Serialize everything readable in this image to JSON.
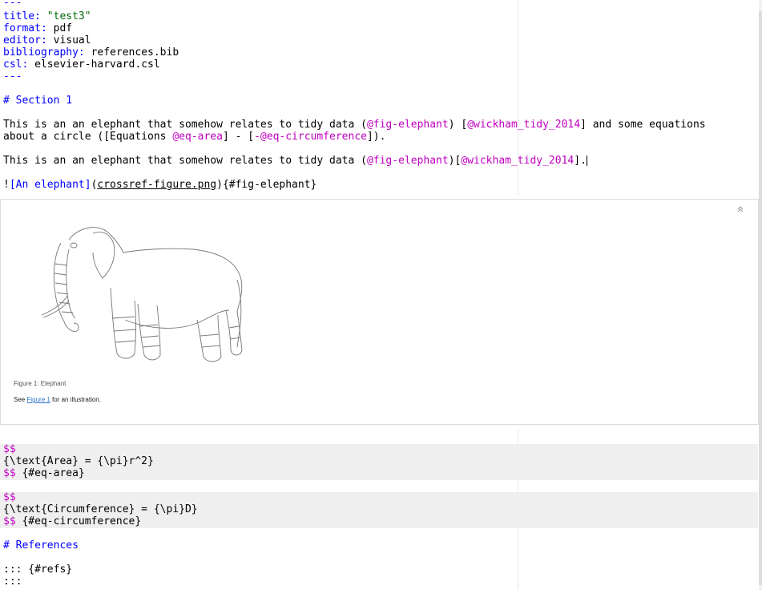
{
  "yaml": {
    "fence": "---",
    "title_key": "title:",
    "title_value": "\"test3\"",
    "format_key": "format:",
    "format_value": "pdf",
    "editor_key": "editor:",
    "editor_value": "visual",
    "bibliography_key": "bibliography:",
    "bibliography_value": "references.bib",
    "csl_key": "csl:",
    "csl_value": "elsevier-harvard.csl"
  },
  "section1": {
    "heading": "# Section 1",
    "para1": {
      "t1": "This is an an elephant that somehow relates to tidy data (",
      "r1": "@fig-elephant",
      "t2": ") [",
      "r2": "@wickham_tidy_2014",
      "t3": "] and some equations",
      "t4": "about a circle ([Equations ",
      "r3": "@eq-area",
      "t5": "] - [",
      "r4": "-@eq-circumference",
      "t6": "])."
    },
    "para2": {
      "t1": "This is an an elephant that somehow relates to tidy data (",
      "r1": "@fig-elephant",
      "t2": ")[",
      "r2": "@wickham_tidy_2014",
      "t3": "]."
    },
    "image_md": {
      "bang": "!",
      "alt": "[An elephant]",
      "open": "(",
      "src": "crossref-figure.png",
      "close": ")",
      "attr": "{#fig-elephant}"
    }
  },
  "preview": {
    "caption": "Figure 1: Elephant",
    "see_prefix": "See ",
    "see_link": "Figure 1",
    "see_suffix": " for an illustration."
  },
  "equations": [
    {
      "open": "$$",
      "body": "{\\text{Area} = {\\pi}r^2}",
      "close": "$$",
      "label": " {#eq-area}"
    },
    {
      "open": "$$",
      "body": "{\\text{Circumference} = {\\pi}D}",
      "close": "$$",
      "label": " {#eq-circumference}"
    }
  ],
  "references": {
    "heading": "# References",
    "div_open": "::: {#refs}",
    "div_close": ":::"
  },
  "colors": {
    "keyword": "#0000ff",
    "string": "#036a07",
    "crossref": "#c000c0",
    "math_background": "#efefef"
  }
}
